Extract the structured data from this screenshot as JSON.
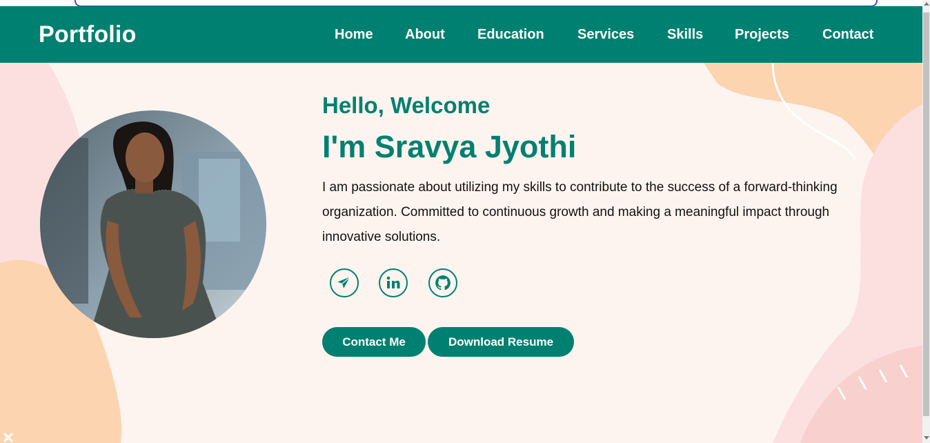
{
  "navbar": {
    "brand": "Portfolio",
    "links": [
      "Home",
      "About",
      "Education",
      "Services",
      "Skills",
      "Projects",
      "Contact"
    ]
  },
  "hero": {
    "greeting": "Hello, Welcome",
    "name": "I'm Sravya Jyothi",
    "intro": "I am passionate about utilizing my skills to contribute to the success of a forward-thinking organization. Committed to continuous growth and making a meaningful impact through innovative solutions.",
    "social_icons": [
      "telegram-icon",
      "linkedin-icon",
      "github-icon"
    ],
    "buttons": {
      "contact": "Contact Me",
      "resume": "Download Resume"
    }
  },
  "colors": {
    "primary": "#008070",
    "background": "#fdf4ef",
    "blob_peach": "#fcd4b0",
    "blob_pink": "#fbe0df"
  }
}
